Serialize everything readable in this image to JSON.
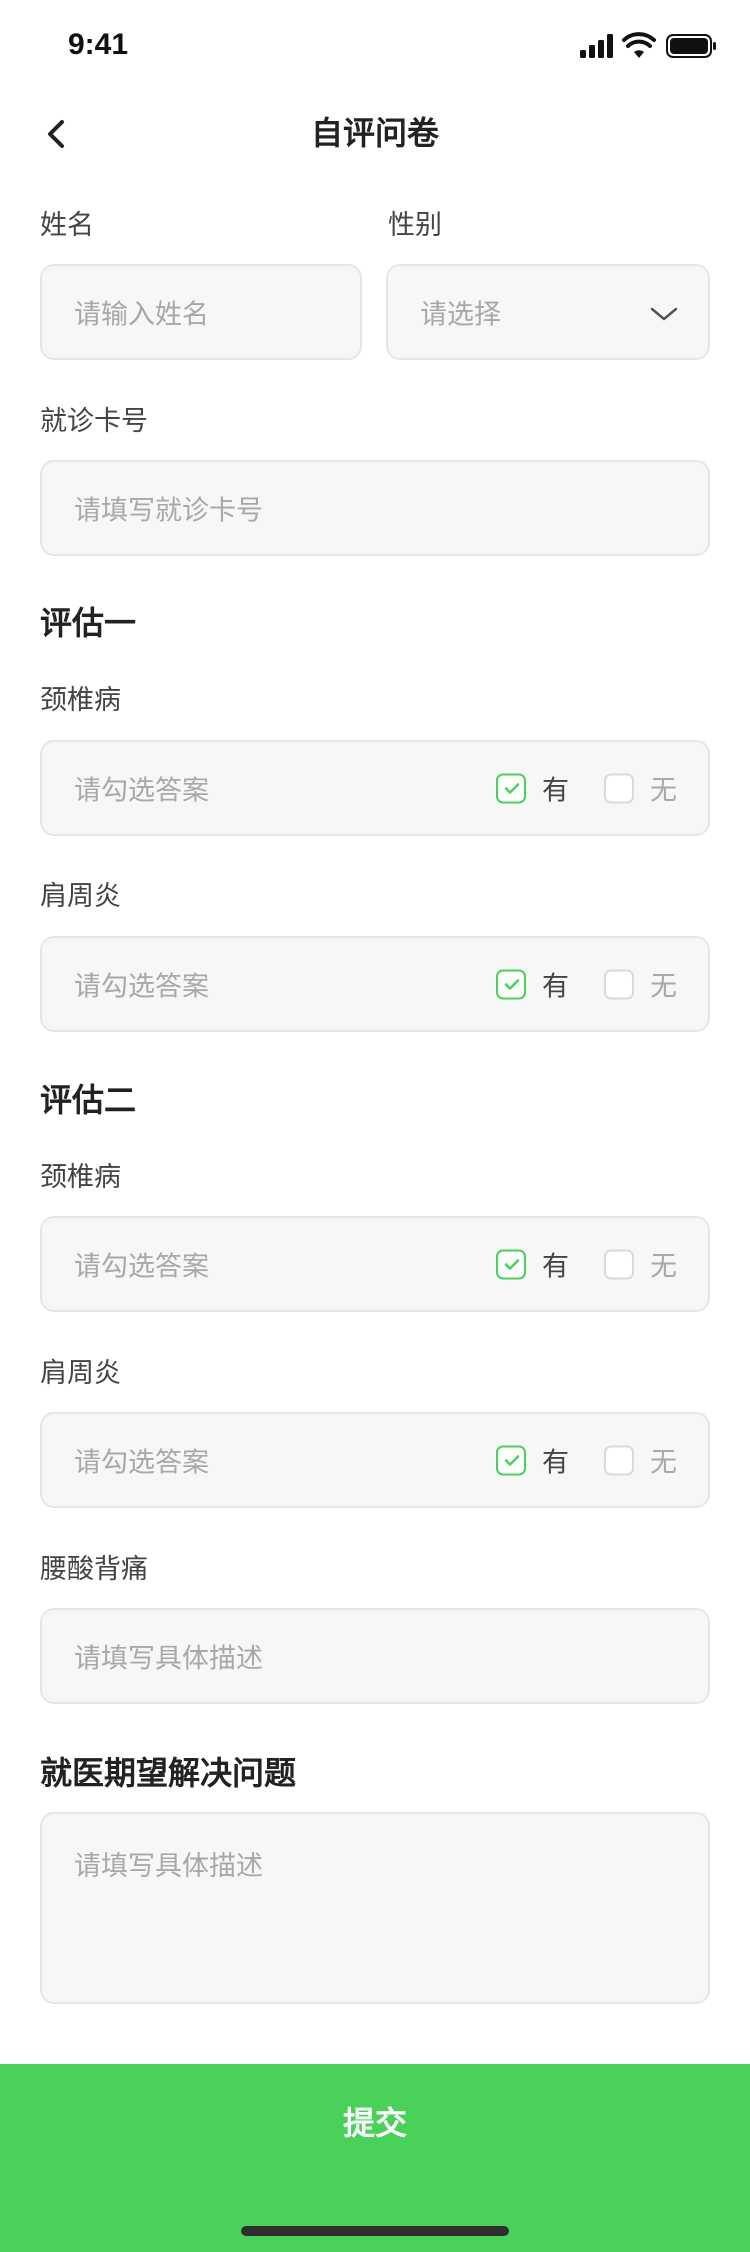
{
  "status_bar": {
    "time": "9:41",
    "signal_icon": "signal-icon",
    "wifi_icon": "wifi-icon",
    "battery_icon": "battery-icon"
  },
  "nav": {
    "back_icon": "back-chevron-icon",
    "title": "自评问卷"
  },
  "form": {
    "name": {
      "label": "姓名",
      "placeholder": "请输入姓名"
    },
    "gender": {
      "label": "性别",
      "placeholder": "请选择",
      "icon": "chevron-down-icon"
    },
    "card_no": {
      "label": "就诊卡号",
      "placeholder": "请填写就诊卡号"
    },
    "section1": {
      "title": "评估一",
      "q1": {
        "label": "颈椎病",
        "placeholder": "请勾选答案",
        "yes": "有",
        "no": "无",
        "selected": "有"
      },
      "q2": {
        "label": "肩周炎",
        "placeholder": "请勾选答案",
        "yes": "有",
        "no": "无",
        "selected": "有"
      }
    },
    "section2": {
      "title": "评估二",
      "q1": {
        "label": "颈椎病",
        "placeholder": "请勾选答案",
        "yes": "有",
        "no": "无",
        "selected": "有"
      },
      "q2": {
        "label": "肩周炎",
        "placeholder": "请勾选答案",
        "yes": "有",
        "no": "无",
        "selected": "有"
      },
      "q3": {
        "label": "腰酸背痛",
        "placeholder": "请填写具体描述"
      }
    },
    "expectation": {
      "title": "就医期望解决问题",
      "placeholder": "请填写具体描述"
    }
  },
  "submit": {
    "label": "提交"
  },
  "colors": {
    "accent": "#4ad15a",
    "field_bg": "#f7f7f7",
    "placeholder": "#a8a8a8"
  }
}
